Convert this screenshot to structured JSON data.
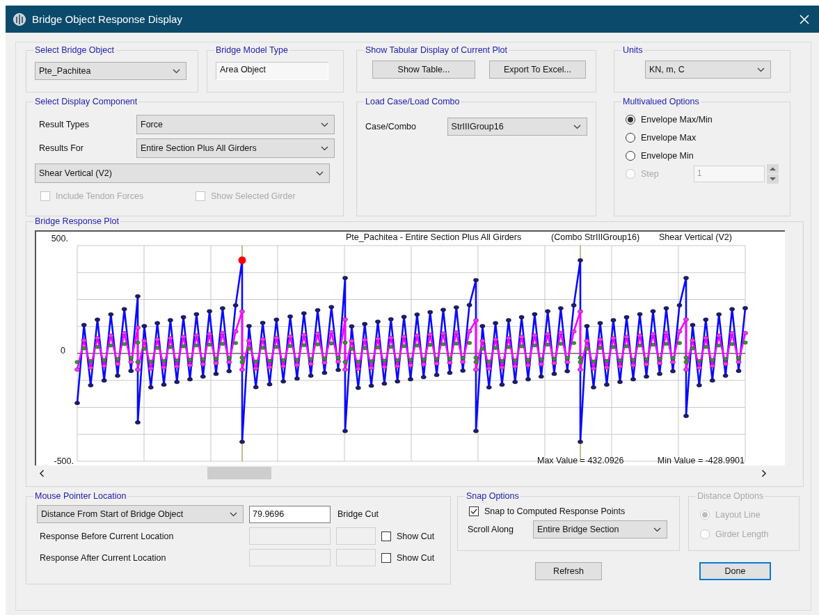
{
  "window": {
    "title": "Bridge Object Response Display"
  },
  "select_bridge_object": {
    "title": "Select Bridge Object",
    "value": "Pte_Pachitea"
  },
  "bridge_model_type": {
    "title": "Bridge Model Type",
    "value": "Area Object"
  },
  "tabular_display": {
    "title": "Show Tabular Display of Current Plot",
    "buttons": [
      "Show Table...",
      "Export To Excel..."
    ]
  },
  "units": {
    "title": "Units",
    "value": "KN, m, C"
  },
  "display_component": {
    "title": "Select Display Component",
    "rows": [
      {
        "label": "Result Types",
        "value": "Force"
      },
      {
        "label": "Results For",
        "value": "Entire Section Plus All Girders"
      }
    ],
    "component": "Shear Vertical  (V2)",
    "options": [
      {
        "label": "Include Tendon Forces",
        "checked": false,
        "disabled": true
      },
      {
        "label": "Show Selected Girder",
        "checked": false,
        "disabled": true
      }
    ]
  },
  "load_case": {
    "title": "Load Case/Load Combo",
    "label": "Case/Combo",
    "value": "StrIIIGroup16"
  },
  "multivalued_options": {
    "title": "Multivalued Options",
    "options": [
      {
        "label": "Envelope Max/Min",
        "selected": true,
        "disabled": false
      },
      {
        "label": "Envelope Max",
        "selected": false,
        "disabled": false
      },
      {
        "label": "Envelope Min",
        "selected": false,
        "disabled": false
      },
      {
        "label": "Step",
        "selected": false,
        "disabled": true
      }
    ],
    "step_value": "1"
  },
  "plot": {
    "title": "Bridge Response Plot",
    "caption_parts": [
      "Pte_Pachitea - Entire Section Plus All Girders",
      "(Combo StrIIIGroup16)",
      "Shear Vertical  (V2)"
    ],
    "y_labels": [
      "500.",
      "0",
      "-500."
    ],
    "max_text": "Max Value = 432.0926",
    "min_text": "Min Value = -428.9901"
  },
  "mouse_pointer": {
    "title": "Mouse Pointer Location",
    "measure": "Distance From Start of Bridge Object",
    "value": "79.9696",
    "value_label": "Bridge Cut",
    "rows": [
      {
        "label": "Response Before Current Location",
        "check_label": "Show Cut",
        "checked": false
      },
      {
        "label": "Response After Current Location",
        "check_label": "Show Cut",
        "checked": false
      }
    ]
  },
  "snap_options": {
    "title": "Snap Options",
    "snap_label": "Snap to Computed Response Points",
    "snap_checked": true,
    "scroll_label": "Scroll Along",
    "scroll_value": "Entire Bridge Section"
  },
  "distance_options": {
    "title": "Distance Options",
    "disabled": true,
    "options": [
      {
        "label": "Layout Line",
        "selected": true
      },
      {
        "label": "Girder Length",
        "selected": false
      }
    ]
  },
  "buttons": [
    {
      "label": "Refresh",
      "default": false
    },
    {
      "label": "Done",
      "default": true
    }
  ]
}
